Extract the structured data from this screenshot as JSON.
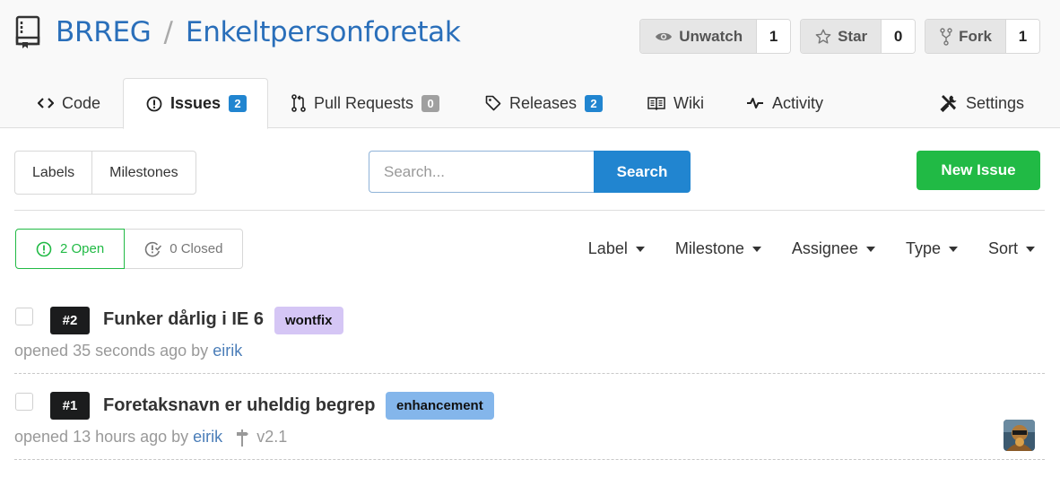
{
  "repo": {
    "owner": "BRREG",
    "separator": "/",
    "name": "Enkeltpersonforetak",
    "icon": "repo-book-icon"
  },
  "repo_actions": [
    {
      "label": "Unwatch",
      "count": "1",
      "icon": "eye-icon"
    },
    {
      "label": "Star",
      "count": "0",
      "icon": "star-icon"
    },
    {
      "label": "Fork",
      "count": "1",
      "icon": "fork-icon"
    }
  ],
  "tabs": {
    "code": {
      "label": "Code"
    },
    "issues": {
      "label": "Issues",
      "badge": "2"
    },
    "pulls": {
      "label": "Pull Requests",
      "badge": "0"
    },
    "releases": {
      "label": "Releases",
      "badge": "2"
    },
    "wiki": {
      "label": "Wiki"
    },
    "activity": {
      "label": "Activity"
    },
    "settings": {
      "label": "Settings"
    }
  },
  "toolbar": {
    "labels": "Labels",
    "milestones": "Milestones",
    "search_placeholder": "Search...",
    "search_value": "",
    "search_button": "Search",
    "new_issue": "New Issue"
  },
  "state_filter": {
    "open": "2 Open",
    "closed": "0 Closed"
  },
  "filters": [
    "Label",
    "Milestone",
    "Assignee",
    "Type",
    "Sort"
  ],
  "issues": [
    {
      "number": "#2",
      "title": "Funker dårlig i IE 6",
      "label": "wontfix",
      "label_color": "#d5c6f5",
      "opened": "opened 35 seconds ago by",
      "author": "eirik",
      "milestone": ""
    },
    {
      "number": "#1",
      "title": "Foretaksnavn er uheldig begrep",
      "label": "enhancement",
      "label_color": "#84b6eb",
      "opened": "opened 13 hours ago by",
      "author": "eirik",
      "milestone": "v2.1"
    }
  ],
  "colors": {
    "link": "#2a6fba",
    "primary": "#2185d0",
    "green": "#21ba45"
  }
}
